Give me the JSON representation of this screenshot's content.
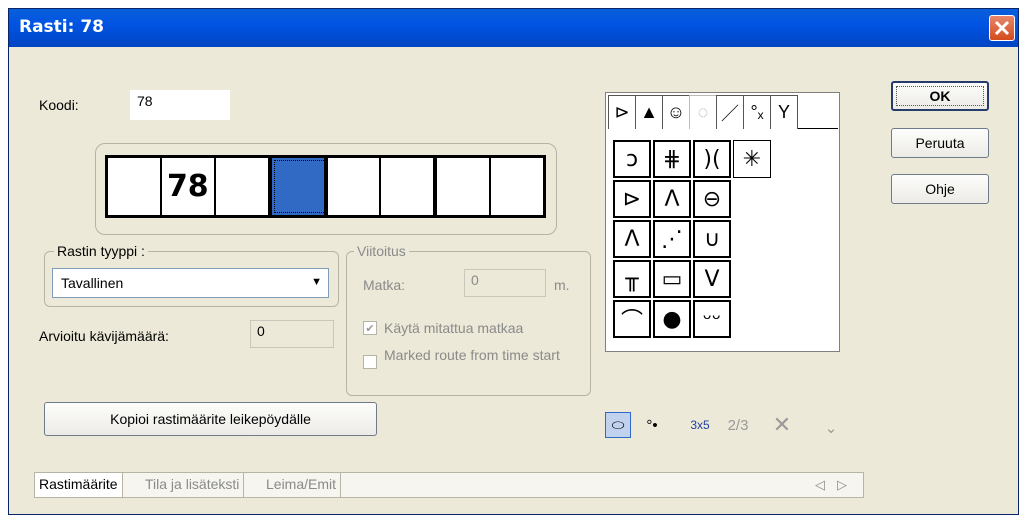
{
  "window": {
    "title": "Rasti: 78"
  },
  "code": {
    "label": "Koodi:",
    "value": "78"
  },
  "code_cells": [
    "",
    "78",
    "",
    "",
    "",
    "",
    "",
    ""
  ],
  "symbol_tabs": [
    "⊳",
    "▲",
    "☺",
    "◌",
    "／",
    "°ₓ",
    "Y"
  ],
  "symbols": [
    [
      "ↄ",
      "⋕",
      ")(",
      "✳"
    ],
    [
      "⊳",
      "Λ",
      "⊖"
    ],
    [
      "Λ",
      "⋰",
      "∪"
    ],
    [
      "╥",
      "▭",
      "V"
    ],
    [
      "⌒",
      "●",
      "ᵕᵕ"
    ]
  ],
  "buttons": {
    "ok": "OK",
    "cancel": "Peruuta",
    "help": "Ohje",
    "copy": "Kopioi rastimäärite leikepöydälle"
  },
  "control_type": {
    "group_label": "Rastin tyyppi :",
    "selected": "Tavallinen"
  },
  "visitors": {
    "label": "Arvioitu kävijämäärä:",
    "value": "0"
  },
  "marking": {
    "group_label": "Viitoitus",
    "distance_label": "Matka:",
    "distance_value": "0",
    "unit": "m.",
    "use_measured_label": "Käytä mitattua matkaa",
    "use_measured_checked": true,
    "marked_route_label": "Marked route from time start",
    "marked_route_checked": false
  },
  "toolbar": {
    "shape": "⬭",
    "dots": "°•",
    "size": "3x5",
    "fraction": "2/3",
    "delete": "✕",
    "more": "⌄"
  },
  "tabs": [
    "Rastimäärite",
    "Tila ja lisäteksti",
    "Leima/Emit"
  ],
  "tab_scroll": {
    "left": "◁",
    "right": "▷"
  }
}
